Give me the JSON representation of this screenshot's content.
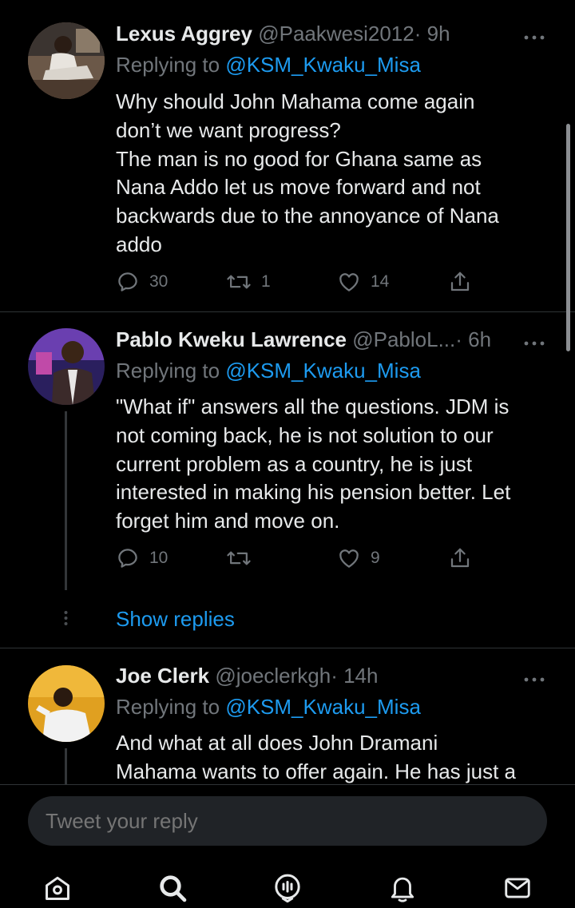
{
  "tweets": [
    {
      "name": "Lexus  Aggrey",
      "handle": "@Paakwesi2012",
      "time": "· 9h",
      "replying_prefix": "Replying to ",
      "replying_handle": "@KSM_Kwaku_Misa",
      "lines": [
        "Why should John Mahama come again",
        "don’t we want progress?",
        "The man is no good for Ghana same as",
        "Nana Addo let us move forward and not",
        "backwards due to the annoyance of Nana",
        "addo"
      ],
      "replies": "30",
      "retweets": "1",
      "likes": "14"
    },
    {
      "name": "Pablo Kweku Lawrence",
      "handle": "@PabloL...",
      "time": "· 6h",
      "replying_prefix": "Replying to ",
      "replying_handle": "@KSM_Kwaku_Misa",
      "lines": [
        "\"What if\" answers all the questions. JDM is",
        "not coming back, he is not solution to our",
        "current problem as a country, he is just",
        "interested in making his pension better. Let",
        "forget him and move on."
      ],
      "replies": "10",
      "retweets": "",
      "likes": "9",
      "show_replies": "Show replies"
    },
    {
      "name": "Joe Clerk",
      "handle": "@joeclerkgh",
      "time": "· 14h",
      "replying_prefix": "Replying to ",
      "replying_handle": "@KSM_Kwaku_Misa",
      "lines": [
        "And what at all does John Dramani",
        "Mahama wants to offer again. He has just a"
      ]
    }
  ],
  "reply_bar": {
    "placeholder": "Tweet your reply"
  },
  "tabs": [
    "home-icon",
    "search-icon",
    "spaces-icon",
    "notifications-icon",
    "messages-icon"
  ],
  "colors": {
    "background": "#000000",
    "text": "#e7e9ea",
    "muted": "#71767b",
    "accent": "#1d9bf0",
    "divider": "#2f3336"
  }
}
